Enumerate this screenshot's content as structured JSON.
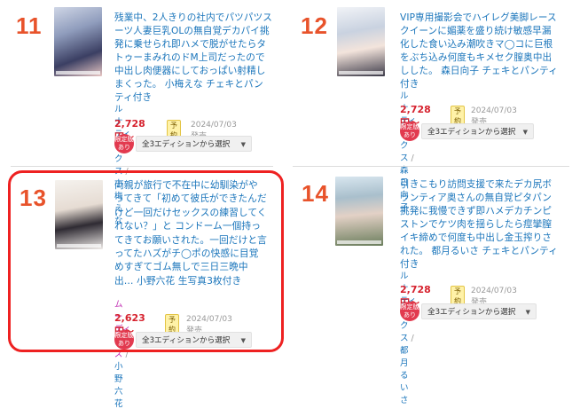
{
  "items": [
    {
      "rank": "11",
      "title": "残業中、2人きりの社内でパツパツスーツ人妻巨乳OLの無自覚デカパイ挑発に乗せられ即ハメで脱がせたらタトゥーまみれのドM上司だったので中出し肉便器にしておっぱい射精しまくった。 小梅えな チェキとパンティ付き",
      "maker": "ルナティックス",
      "actress": "小梅えな",
      "price": "2,728円〜",
      "badge": "予約",
      "date": "2024/07/03発売",
      "limited": "限定版あり",
      "select": "全3エディションから選択"
    },
    {
      "rank": "12",
      "title": "VIP専用撮影会でハイレグ美脚レースクイーンに媚薬を盛り続け敏感早漏化した食い込み潮吹きマ◯コに巨根をぶち込み何度もキメセク膣奥中出しした。 森日向子 チェキとパンティ付き",
      "maker": "ルナティックス",
      "actress": "森日向子",
      "price": "2,728円〜",
      "badge": "予約",
      "date": "2024/07/03発売",
      "limited": "限定版あり",
      "select": "全3エディションから選択"
    },
    {
      "rank": "13",
      "title": "両親が旅行で不在中に幼馴染がやってきて「初めて彼氏ができたんだけど一回だけセックスの練習してくれない？」と コンドーム一個持ってきてお願いされた。一回だけと言ってたハズがチ◯ポの快感に目覚めすぎてゴム無しで三日三晩中出… 小野六花 生写真3枚付き",
      "maker": "ムーディーズ",
      "actress": "小野六花",
      "price": "2,623円〜",
      "badge": "予約",
      "date": "2024/07/03発売",
      "limited": "限定版あり",
      "select": "全3エディションから選択"
    },
    {
      "rank": "14",
      "title": "引きこもり訪問支援で来たデカ尻ボランティア奥さんの無自覚ピタパン挑発に我慢できず即ハメデカチンピストンでケツ肉を揺らしたら痙攣膣イキ締めで何度も中出し金玉搾りされた。 都月るいさ チェキとパンティ付き",
      "maker": "ルナティックス",
      "actress": "都月るいさ",
      "price": "2,728円〜",
      "badge": "予約",
      "date": "2024/07/03発売",
      "limited": "限定版あり",
      "select": "全3エディションから選択"
    }
  ],
  "colors": {
    "rank": "#e8532b",
    "title": "#1a75bb",
    "price": "#d6222e",
    "highlight": "#ee2121"
  }
}
